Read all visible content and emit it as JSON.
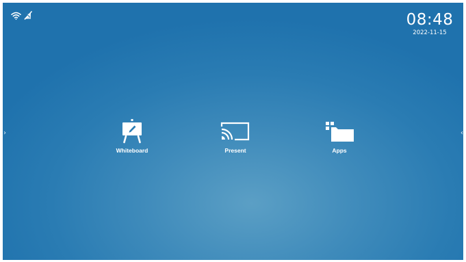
{
  "status": {
    "icons": [
      "wifi-icon",
      "network-disconnected-icon"
    ]
  },
  "clock": {
    "time": "08:48",
    "date": "2022-11-15"
  },
  "navigation": {
    "left_arrow": "›",
    "right_arrow": "‹"
  },
  "launchers": [
    {
      "label": "Whiteboard",
      "icon": "whiteboard-easel-icon"
    },
    {
      "label": "Present",
      "icon": "cast-icon"
    },
    {
      "label": "Apps",
      "icon": "apps-folder-icon"
    }
  ],
  "colors": {
    "background_center": "#5b9fc5",
    "background_edge": "#1f72ad",
    "foreground": "#ffffff"
  }
}
